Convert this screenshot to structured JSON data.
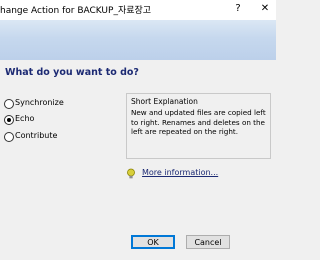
{
  "window": {
    "title": "hange Action for BACKUP_자료장고",
    "help_glyph": "?",
    "close_glyph": "✕"
  },
  "main": {
    "question": "What do you want to do?",
    "options": [
      {
        "label": "Synchronize",
        "selected": false
      },
      {
        "label": "Echo",
        "selected": true
      },
      {
        "label": "Contribute",
        "selected": false
      }
    ],
    "explanation": {
      "title": "Short Explanation",
      "text": "New and updated files are copied left to right. Renames and deletes on the left are repeated on the right."
    },
    "more_info_link": "More information..."
  },
  "buttons": {
    "ok": "OK",
    "cancel": "Cancel"
  },
  "colors": {
    "heading": "#1c2a73",
    "banner": "#c6d8ee",
    "hint_icon": "#a8a000"
  }
}
